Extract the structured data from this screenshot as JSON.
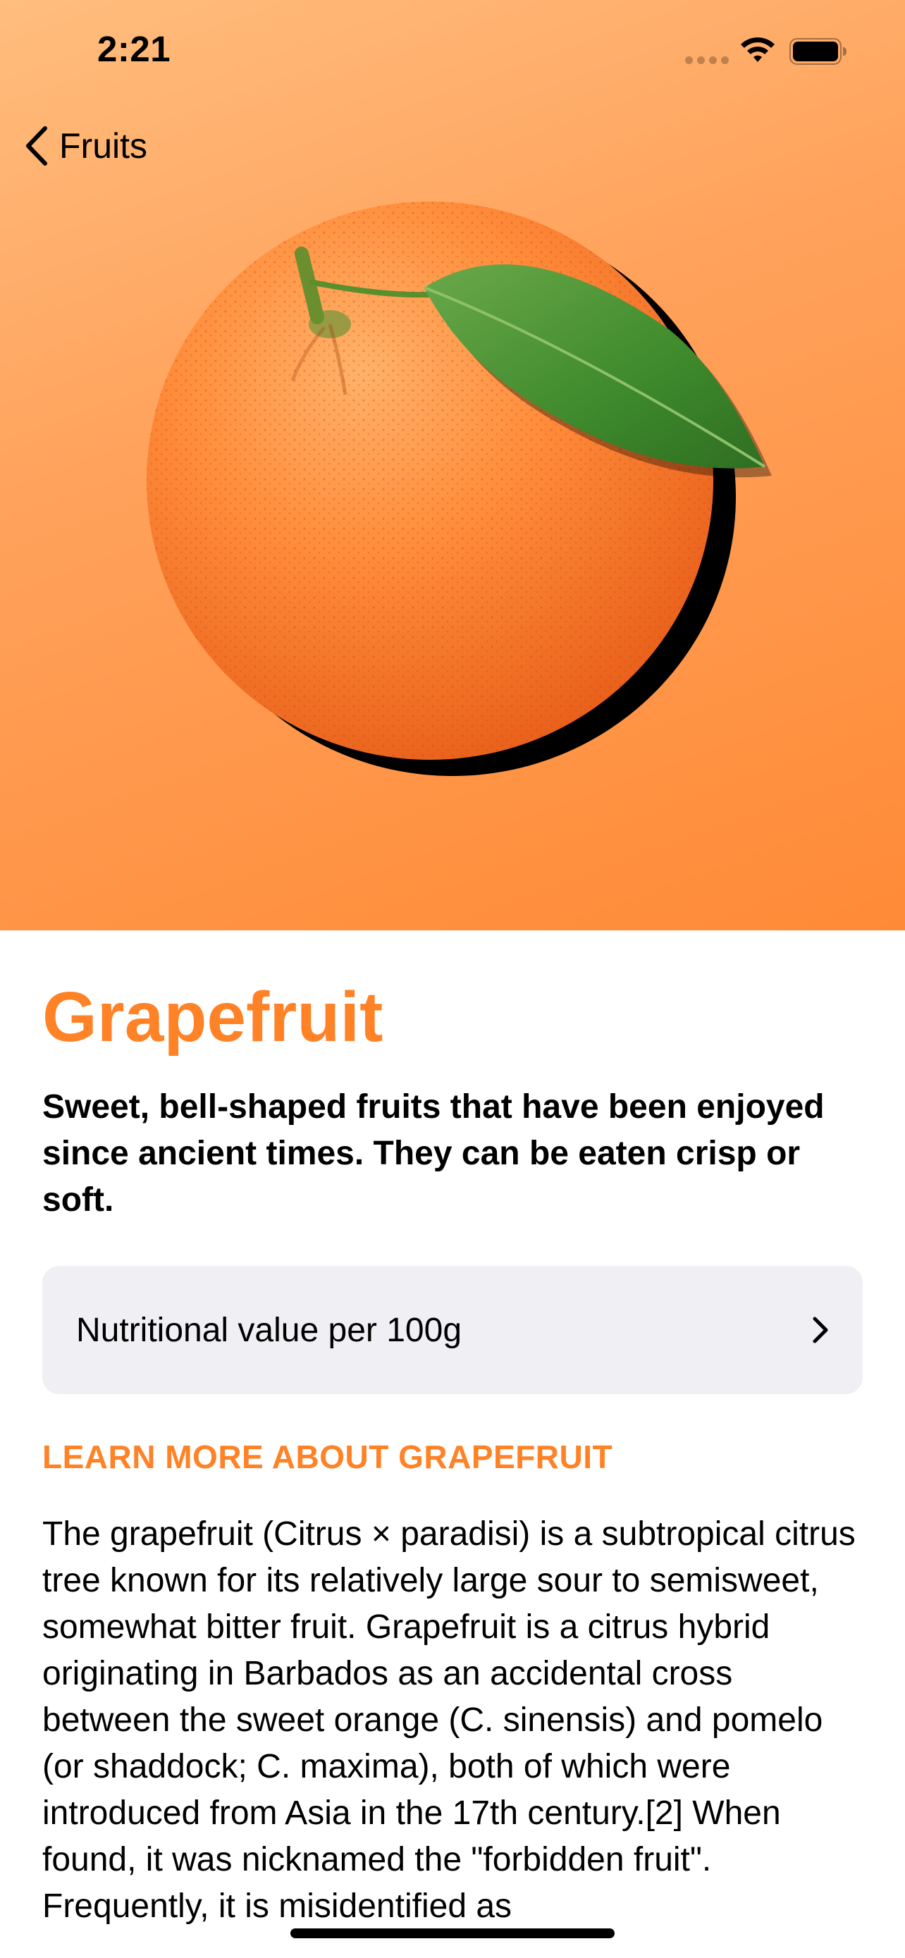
{
  "status_bar": {
    "time": "2:21"
  },
  "nav": {
    "back_label": "Fruits"
  },
  "fruit": {
    "title": "Grapefruit",
    "headline": "Sweet, bell-shaped fruits that have been enjoyed since ancient times. They can be eaten crisp or soft.",
    "nutrition_label": "Nutritional value per 100g",
    "learn_more_title": "LEARN MORE ABOUT GRAPEFRUIT",
    "description": "The grapefruit (Citrus × paradisi) is a subtropical citrus tree known for its relatively large sour to semisweet, somewhat bitter fruit. Grapefruit is a citrus hybrid originating in Barbados as an accidental cross between the sweet orange (C. sinensis) and pomelo (or shaddock; C. maxima), both of which were introduced from Asia in the 17th century.[2] When found, it was nicknamed the \"forbidden fruit\". Frequently, it is misidentified as"
  },
  "colors": {
    "accent": "#ff8226",
    "gradient_light": "#ffbd7e",
    "gradient_dark": "#ff8a36",
    "row_background": "#efeff4"
  },
  "icons": {
    "back": "chevron-left-icon",
    "nutrition_disclosure": "chevron-right-icon",
    "wifi": "wifi-icon",
    "battery": "battery-icon"
  }
}
